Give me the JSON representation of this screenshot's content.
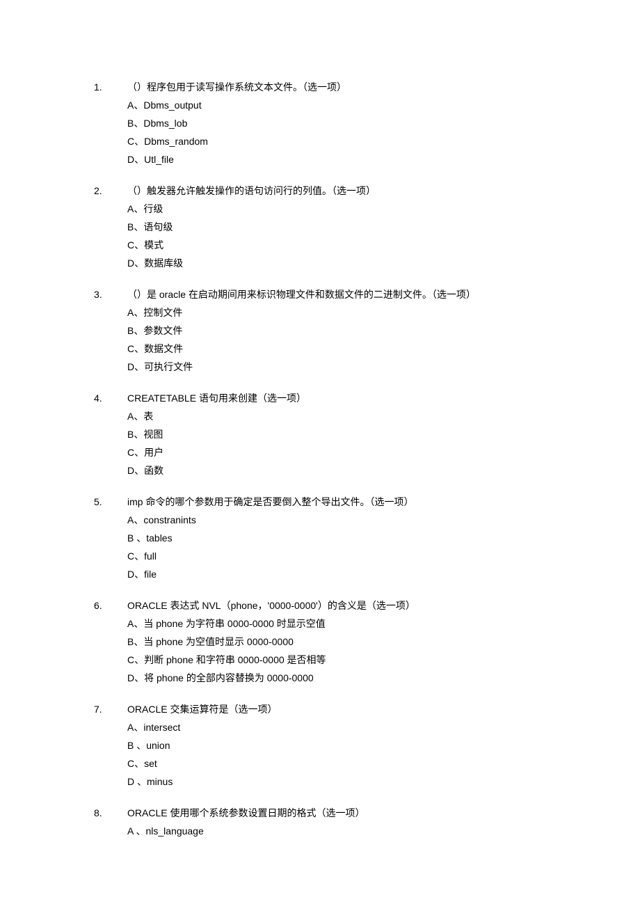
{
  "questions": [
    {
      "number": "1.",
      "text": "（）程序包用于读写操作系统文本文件。（选一项）",
      "options": [
        "A、Dbms_output",
        "B、Dbms_lob",
        "C、Dbms_random",
        "D、Utl_file"
      ]
    },
    {
      "number": "2.",
      "text": "（）触发器允许触发操作的语句访问行的列值。（选一项）",
      "options": [
        "A、行级",
        "B、语句级",
        "C、模式",
        "D、数据库级"
      ]
    },
    {
      "number": "3.",
      "text": "（）是 oracle 在启动期间用来标识物理文件和数据文件的二进制文件。（选一项）",
      "options": [
        "A、控制文件",
        "B、参数文件",
        "C、数据文件",
        "D、可执行文件"
      ]
    },
    {
      "number": "4.",
      "text": "CREATETABLE 语句用来创建（选一项）",
      "options": [
        "A、表",
        "B、视图",
        "C、用户",
        "D、函数"
      ]
    },
    {
      "number": "5.",
      "text": "imp 命令的哪个参数用于确定是否要倒入整个导出文件。（选一项）",
      "options": [
        "A、constranints",
        "B 、tables",
        "C、full",
        "D、file"
      ]
    },
    {
      "number": "6.",
      "text": "ORACLE 表达式 NVL（phone，'0000-0000'）的含义是（选一项）",
      "options": [
        "A、当 phone 为字符串 0000-0000 时显示空值",
        "B、当 phone 为空值时显示 0000-0000",
        "C、判断 phone 和字符串 0000-0000 是否相等",
        "D、将 phone 的全部内容替换为 0000-0000"
      ]
    },
    {
      "number": "7.",
      "text": "ORACLE 交集运算符是（选一项）",
      "options": [
        "A、intersect",
        "B 、union",
        "C、set",
        "D 、minus"
      ]
    },
    {
      "number": "8.",
      "text": "ORACLE 使用哪个系统参数设置日期的格式（选一项）",
      "options": [
        "A 、nls_language"
      ]
    }
  ]
}
